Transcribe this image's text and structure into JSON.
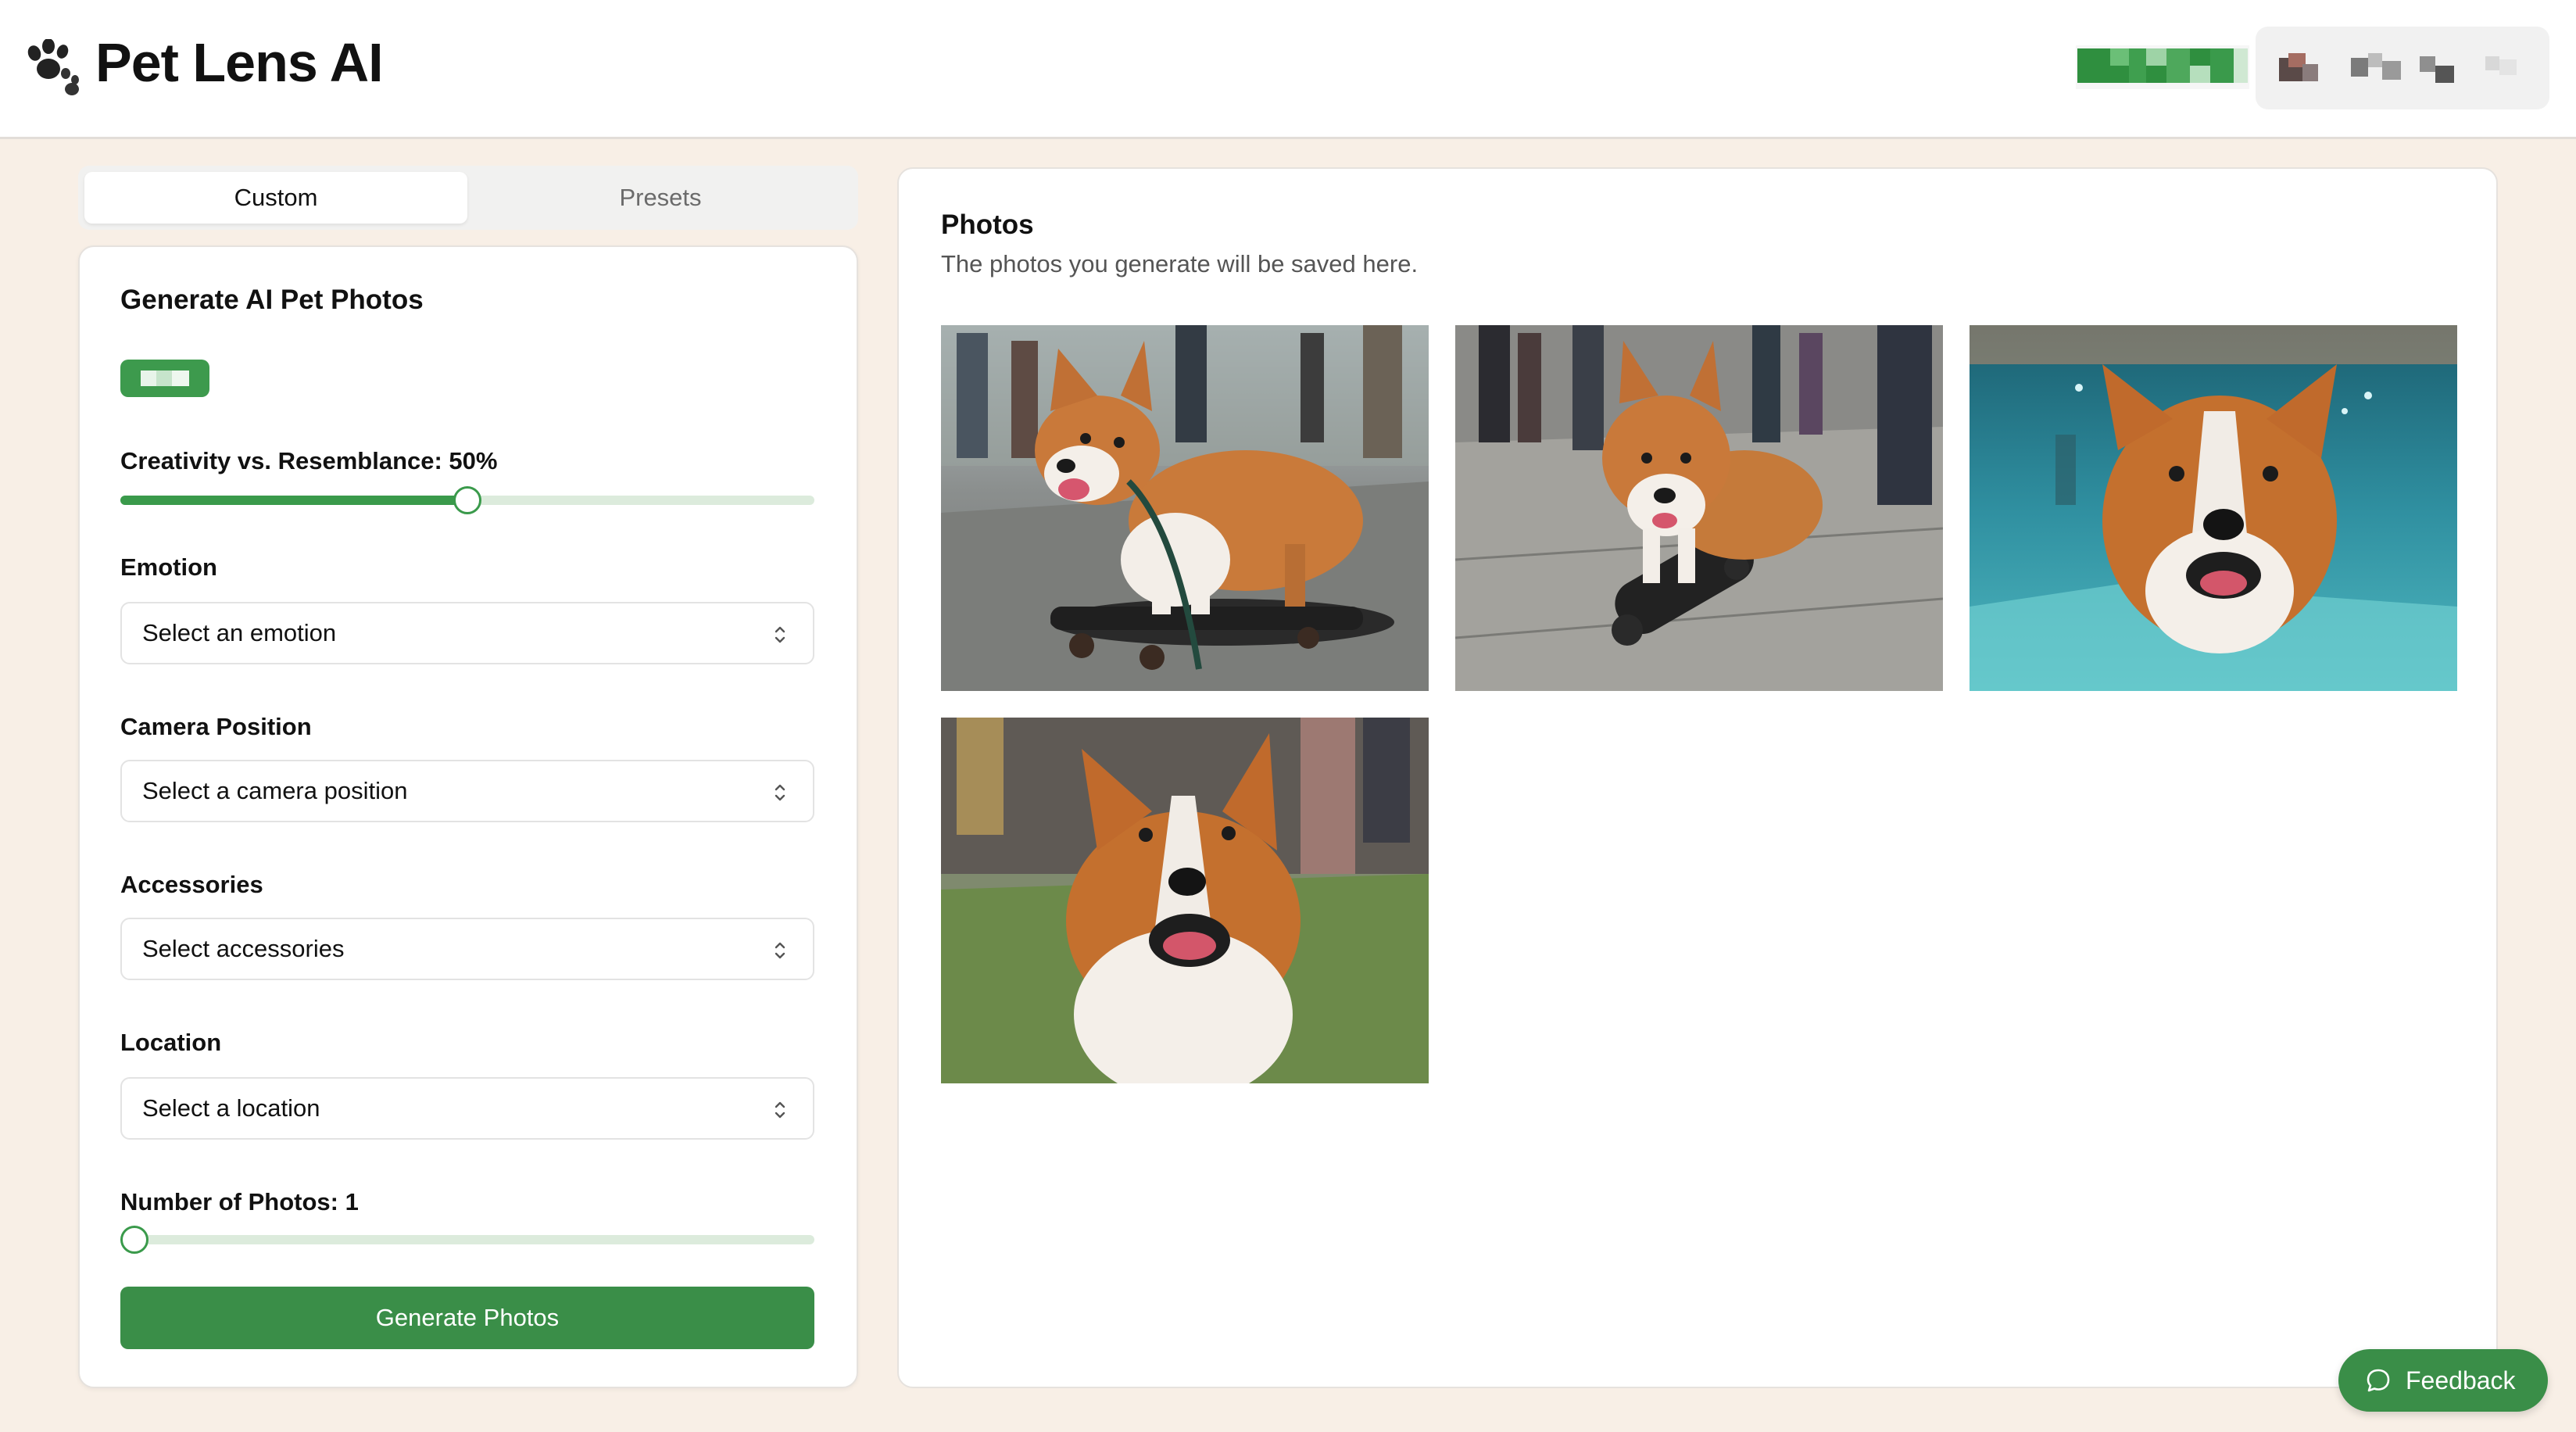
{
  "header": {
    "app_title": "Pet Lens AI",
    "logo_icon": "paw-print-icon"
  },
  "tabs": [
    {
      "label": "Custom",
      "active": true
    },
    {
      "label": "Presets",
      "active": false
    }
  ],
  "form": {
    "title": "Generate AI Pet Photos",
    "creativity_label": "Creativity vs. Resemblance: 50%",
    "creativity_value_percent": 50,
    "emotion": {
      "label": "Emotion",
      "value": "Select an emotion"
    },
    "camera_position": {
      "label": "Camera Position",
      "value": "Select a camera position"
    },
    "accessories": {
      "label": "Accessories",
      "value": "Select accessories"
    },
    "location": {
      "label": "Location",
      "value": "Select a location"
    },
    "number_of_photos_label": "Number of Photos: 1",
    "number_of_photos_fraction": 0,
    "generate_label": "Generate Photos"
  },
  "photos": {
    "title": "Photos",
    "subtitle": "The photos you generate will be saved here.",
    "items": [
      {
        "scene": "corgi-on-skateboard-street"
      },
      {
        "scene": "corgi-on-skateboard-crowd"
      },
      {
        "scene": "corgi-underwater-pool"
      },
      {
        "scene": "corgi-on-grass-park"
      }
    ]
  },
  "feedback": {
    "label": "Feedback",
    "icon": "chat-bubble-icon"
  },
  "colors": {
    "accent": "#3a8e48",
    "background": "#f8efe6",
    "panel": "#ffffff"
  }
}
